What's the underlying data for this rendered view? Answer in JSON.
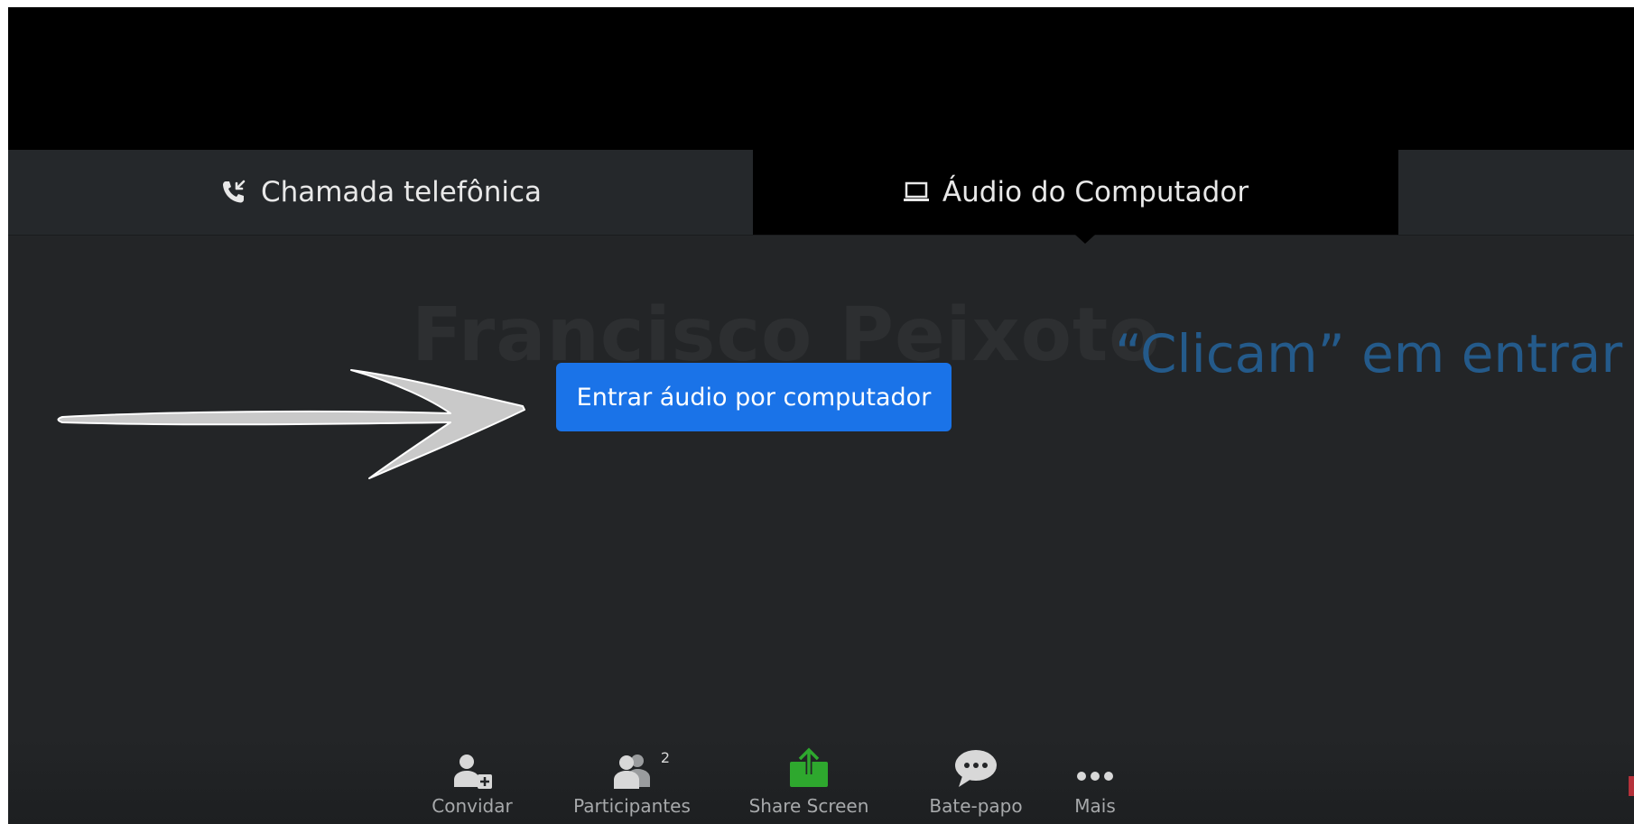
{
  "tabs": {
    "phone_label": "Chamada telefônica",
    "computer_label": "Áudio do Computador"
  },
  "watermark": "Francisco Peixoto",
  "annotation": "“Clicam” em entrar",
  "join_button": "Entrar áudio por computador",
  "toolbar": {
    "invite": "Convidar",
    "participants": "Participantes",
    "participants_count": "2",
    "share": "Share Screen",
    "chat": "Bate-papo",
    "more": "Mais"
  },
  "colors": {
    "accent_blue": "#1a73e8",
    "share_green": "#2ea82e",
    "annotation_blue": "#245a8a"
  }
}
